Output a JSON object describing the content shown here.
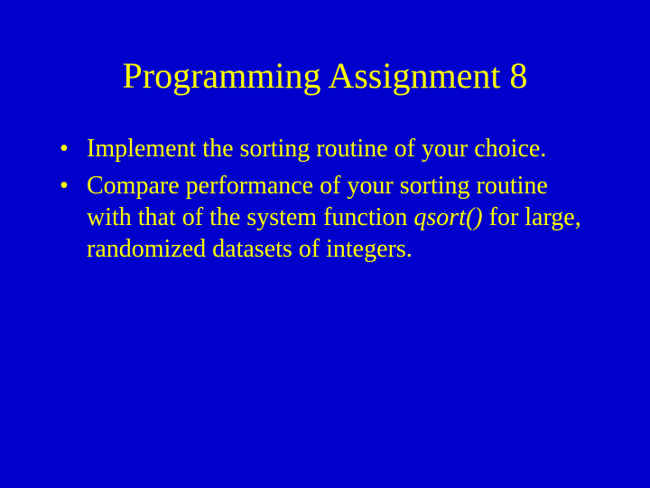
{
  "slide": {
    "title": "Programming Assignment 8",
    "bullets": [
      {
        "text_before": "Implement the sorting routine of your choice.",
        "emph": "",
        "text_after": ""
      },
      {
        "text_before": "Compare performance of your sorting routine with that of the system function ",
        "emph": "qsort()",
        "text_after": " for large, randomized datasets of integers."
      }
    ],
    "colors": {
      "background": "#0000CC",
      "text": "#FFFF00"
    }
  }
}
